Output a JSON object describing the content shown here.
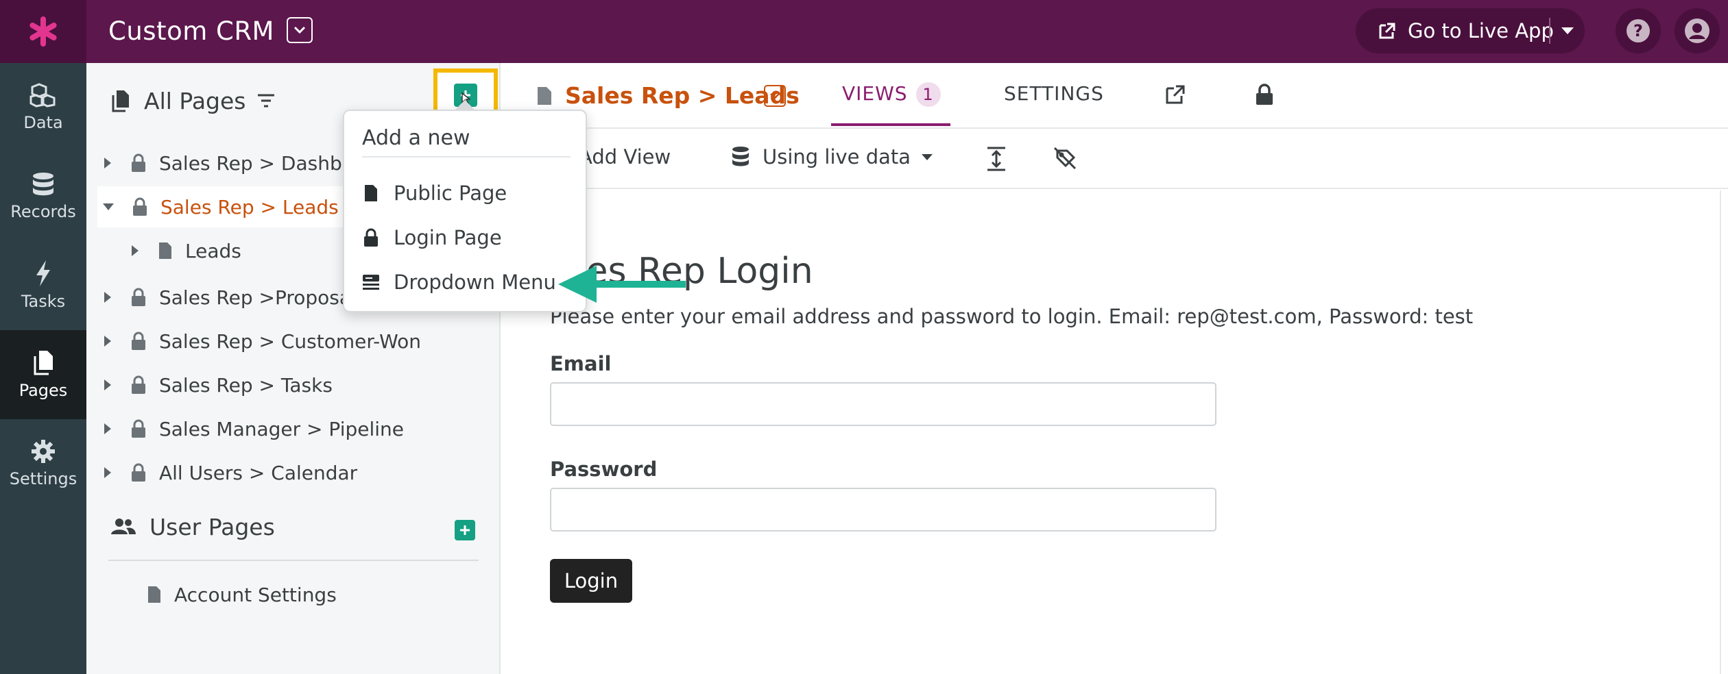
{
  "topbar": {
    "app_title": "Custom CRM",
    "live_app_label": "Go to Live App"
  },
  "leftnav": {
    "items": [
      {
        "label": "Data",
        "icon": "cubes-icon"
      },
      {
        "label": "Records",
        "icon": "database-icon"
      },
      {
        "label": "Tasks",
        "icon": "bolt-icon"
      },
      {
        "label": "Pages",
        "icon": "pages-icon",
        "active": true
      },
      {
        "label": "Settings",
        "icon": "gear-icon"
      }
    ]
  },
  "sidebar": {
    "header": "All Pages",
    "tree": [
      {
        "label": "Sales Rep > Dashbo",
        "icon": "lock-icon"
      },
      {
        "label": "Sales Rep > Leads",
        "icon": "lock-icon",
        "selected": true,
        "expanded": true
      },
      {
        "label": "Leads",
        "icon": "page-icon",
        "child": true
      },
      {
        "label": "Sales Rep >Proposa",
        "icon": "lock-icon"
      },
      {
        "label": "Sales Rep > Customer-Won",
        "icon": "lock-icon"
      },
      {
        "label": "Sales Rep > Tasks",
        "icon": "lock-icon"
      },
      {
        "label": "Sales Manager > Pipeline",
        "icon": "lock-icon"
      },
      {
        "label": "All Users > Calendar",
        "icon": "lock-icon"
      }
    ],
    "user_pages_header": "User Pages",
    "user_pages": [
      {
        "label": "Account Settings",
        "icon": "page-icon"
      }
    ]
  },
  "popover": {
    "title": "Add a new",
    "items": [
      {
        "label": "Public Page",
        "icon": "page-icon"
      },
      {
        "label": "Login Page",
        "icon": "lock-icon"
      },
      {
        "label": "Dropdown Menu",
        "icon": "menu-icon"
      }
    ]
  },
  "main": {
    "page_title": "Sales Rep > Leads",
    "tabs": {
      "views": "VIEWS",
      "views_count": "1",
      "settings": "SETTINGS"
    },
    "toolbar": {
      "add_view": "Add View",
      "data_source": "Using live data"
    },
    "login": {
      "heading": "les Rep Login",
      "subtitle": "Please enter your email address and password to login. Email: rep@test.com, Password: test",
      "email_label": "Email",
      "password_label": "Password",
      "button": "Login"
    }
  },
  "colors": {
    "topbar": "#5c174d",
    "nav": "#2d3e45",
    "accent_orange": "#c8510d",
    "accent_purple": "#8a1d6e",
    "add_green": "#15a083",
    "highlight": "#f5b800",
    "arrow": "#1db394"
  }
}
